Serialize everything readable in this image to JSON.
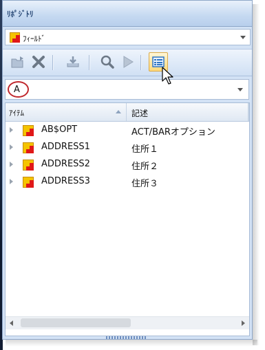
{
  "panel": {
    "title": "ﾘﾎﾟｼﾞﾄﾘ"
  },
  "field_combo": {
    "value": "ﾌｨｰﾙﾄﾞ"
  },
  "toolbar": {
    "buttons": [
      {
        "name": "open-folder-icon"
      },
      {
        "name": "delete-icon"
      },
      {
        "name": "import-icon"
      },
      {
        "name": "search-icon"
      },
      {
        "name": "play-icon"
      },
      {
        "name": "properties-icon",
        "active": true
      }
    ]
  },
  "search_combo": {
    "value": "A"
  },
  "grid": {
    "columns": [
      "ｱｲﾃﾑ",
      "記述"
    ],
    "rows": [
      {
        "name": "AB$OPT",
        "desc": "ACT/BARオプション"
      },
      {
        "name": "ADDRESS1",
        "desc": "住所１"
      },
      {
        "name": "ADDRESS2",
        "desc": "住所２"
      },
      {
        "name": "ADDRESS3",
        "desc": "住所３"
      }
    ]
  },
  "colors": {
    "accent": "#c5d9f1",
    "highlight": "#ffd97a",
    "annotation": "#c0282d"
  }
}
